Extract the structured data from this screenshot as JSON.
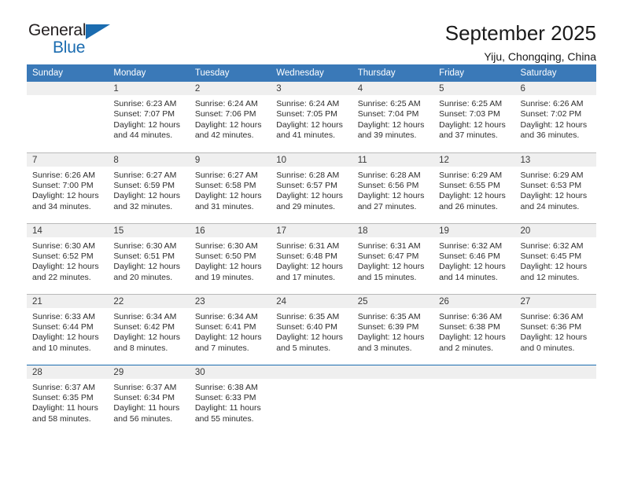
{
  "logo": {
    "word_top": "General",
    "word_bottom": "Blue",
    "triangle_color": "#1b6cb0"
  },
  "header": {
    "title": "September 2025",
    "location": "Yiju, Chongqing, China"
  },
  "theme": {
    "header_blue": "#3a79b8",
    "accent_blue": "#1b6cb0",
    "daynum_band": "#efefef",
    "row_divider": "#b9b9b9"
  },
  "calendar": {
    "weekdays": [
      "Sunday",
      "Monday",
      "Tuesday",
      "Wednesday",
      "Thursday",
      "Friday",
      "Saturday"
    ],
    "weeks": [
      [
        {
          "day": "",
          "sunrise": "",
          "sunset": "",
          "daylight_line1": "",
          "daylight_line2": "",
          "empty": true
        },
        {
          "day": "1",
          "sunrise": "Sunrise: 6:23 AM",
          "sunset": "Sunset: 7:07 PM",
          "daylight_line1": "Daylight: 12 hours",
          "daylight_line2": "and 44 minutes."
        },
        {
          "day": "2",
          "sunrise": "Sunrise: 6:24 AM",
          "sunset": "Sunset: 7:06 PM",
          "daylight_line1": "Daylight: 12 hours",
          "daylight_line2": "and 42 minutes."
        },
        {
          "day": "3",
          "sunrise": "Sunrise: 6:24 AM",
          "sunset": "Sunset: 7:05 PM",
          "daylight_line1": "Daylight: 12 hours",
          "daylight_line2": "and 41 minutes."
        },
        {
          "day": "4",
          "sunrise": "Sunrise: 6:25 AM",
          "sunset": "Sunset: 7:04 PM",
          "daylight_line1": "Daylight: 12 hours",
          "daylight_line2": "and 39 minutes."
        },
        {
          "day": "5",
          "sunrise": "Sunrise: 6:25 AM",
          "sunset": "Sunset: 7:03 PM",
          "daylight_line1": "Daylight: 12 hours",
          "daylight_line2": "and 37 minutes."
        },
        {
          "day": "6",
          "sunrise": "Sunrise: 6:26 AM",
          "sunset": "Sunset: 7:02 PM",
          "daylight_line1": "Daylight: 12 hours",
          "daylight_line2": "and 36 minutes."
        }
      ],
      [
        {
          "day": "7",
          "sunrise": "Sunrise: 6:26 AM",
          "sunset": "Sunset: 7:00 PM",
          "daylight_line1": "Daylight: 12 hours",
          "daylight_line2": "and 34 minutes."
        },
        {
          "day": "8",
          "sunrise": "Sunrise: 6:27 AM",
          "sunset": "Sunset: 6:59 PM",
          "daylight_line1": "Daylight: 12 hours",
          "daylight_line2": "and 32 minutes."
        },
        {
          "day": "9",
          "sunrise": "Sunrise: 6:27 AM",
          "sunset": "Sunset: 6:58 PM",
          "daylight_line1": "Daylight: 12 hours",
          "daylight_line2": "and 31 minutes."
        },
        {
          "day": "10",
          "sunrise": "Sunrise: 6:28 AM",
          "sunset": "Sunset: 6:57 PM",
          "daylight_line1": "Daylight: 12 hours",
          "daylight_line2": "and 29 minutes."
        },
        {
          "day": "11",
          "sunrise": "Sunrise: 6:28 AM",
          "sunset": "Sunset: 6:56 PM",
          "daylight_line1": "Daylight: 12 hours",
          "daylight_line2": "and 27 minutes."
        },
        {
          "day": "12",
          "sunrise": "Sunrise: 6:29 AM",
          "sunset": "Sunset: 6:55 PM",
          "daylight_line1": "Daylight: 12 hours",
          "daylight_line2": "and 26 minutes."
        },
        {
          "day": "13",
          "sunrise": "Sunrise: 6:29 AM",
          "sunset": "Sunset: 6:53 PM",
          "daylight_line1": "Daylight: 12 hours",
          "daylight_line2": "and 24 minutes."
        }
      ],
      [
        {
          "day": "14",
          "sunrise": "Sunrise: 6:30 AM",
          "sunset": "Sunset: 6:52 PM",
          "daylight_line1": "Daylight: 12 hours",
          "daylight_line2": "and 22 minutes."
        },
        {
          "day": "15",
          "sunrise": "Sunrise: 6:30 AM",
          "sunset": "Sunset: 6:51 PM",
          "daylight_line1": "Daylight: 12 hours",
          "daylight_line2": "and 20 minutes."
        },
        {
          "day": "16",
          "sunrise": "Sunrise: 6:30 AM",
          "sunset": "Sunset: 6:50 PM",
          "daylight_line1": "Daylight: 12 hours",
          "daylight_line2": "and 19 minutes."
        },
        {
          "day": "17",
          "sunrise": "Sunrise: 6:31 AM",
          "sunset": "Sunset: 6:48 PM",
          "daylight_line1": "Daylight: 12 hours",
          "daylight_line2": "and 17 minutes."
        },
        {
          "day": "18",
          "sunrise": "Sunrise: 6:31 AM",
          "sunset": "Sunset: 6:47 PM",
          "daylight_line1": "Daylight: 12 hours",
          "daylight_line2": "and 15 minutes."
        },
        {
          "day": "19",
          "sunrise": "Sunrise: 6:32 AM",
          "sunset": "Sunset: 6:46 PM",
          "daylight_line1": "Daylight: 12 hours",
          "daylight_line2": "and 14 minutes."
        },
        {
          "day": "20",
          "sunrise": "Sunrise: 6:32 AM",
          "sunset": "Sunset: 6:45 PM",
          "daylight_line1": "Daylight: 12 hours",
          "daylight_line2": "and 12 minutes."
        }
      ],
      [
        {
          "day": "21",
          "sunrise": "Sunrise: 6:33 AM",
          "sunset": "Sunset: 6:44 PM",
          "daylight_line1": "Daylight: 12 hours",
          "daylight_line2": "and 10 minutes."
        },
        {
          "day": "22",
          "sunrise": "Sunrise: 6:34 AM",
          "sunset": "Sunset: 6:42 PM",
          "daylight_line1": "Daylight: 12 hours",
          "daylight_line2": "and 8 minutes."
        },
        {
          "day": "23",
          "sunrise": "Sunrise: 6:34 AM",
          "sunset": "Sunset: 6:41 PM",
          "daylight_line1": "Daylight: 12 hours",
          "daylight_line2": "and 7 minutes."
        },
        {
          "day": "24",
          "sunrise": "Sunrise: 6:35 AM",
          "sunset": "Sunset: 6:40 PM",
          "daylight_line1": "Daylight: 12 hours",
          "daylight_line2": "and 5 minutes."
        },
        {
          "day": "25",
          "sunrise": "Sunrise: 6:35 AM",
          "sunset": "Sunset: 6:39 PM",
          "daylight_line1": "Daylight: 12 hours",
          "daylight_line2": "and 3 minutes."
        },
        {
          "day": "26",
          "sunrise": "Sunrise: 6:36 AM",
          "sunset": "Sunset: 6:38 PM",
          "daylight_line1": "Daylight: 12 hours",
          "daylight_line2": "and 2 minutes."
        },
        {
          "day": "27",
          "sunrise": "Sunrise: 6:36 AM",
          "sunset": "Sunset: 6:36 PM",
          "daylight_line1": "Daylight: 12 hours",
          "daylight_line2": "and 0 minutes."
        }
      ],
      [
        {
          "day": "28",
          "sunrise": "Sunrise: 6:37 AM",
          "sunset": "Sunset: 6:35 PM",
          "daylight_line1": "Daylight: 11 hours",
          "daylight_line2": "and 58 minutes."
        },
        {
          "day": "29",
          "sunrise": "Sunrise: 6:37 AM",
          "sunset": "Sunset: 6:34 PM",
          "daylight_line1": "Daylight: 11 hours",
          "daylight_line2": "and 56 minutes."
        },
        {
          "day": "30",
          "sunrise": "Sunrise: 6:38 AM",
          "sunset": "Sunset: 6:33 PM",
          "daylight_line1": "Daylight: 11 hours",
          "daylight_line2": "and 55 minutes."
        },
        {
          "day": "",
          "sunrise": "",
          "sunset": "",
          "daylight_line1": "",
          "daylight_line2": "",
          "empty": true
        },
        {
          "day": "",
          "sunrise": "",
          "sunset": "",
          "daylight_line1": "",
          "daylight_line2": "",
          "empty": true
        },
        {
          "day": "",
          "sunrise": "",
          "sunset": "",
          "daylight_line1": "",
          "daylight_line2": "",
          "empty": true
        },
        {
          "day": "",
          "sunrise": "",
          "sunset": "",
          "daylight_line1": "",
          "daylight_line2": "",
          "empty": true
        }
      ]
    ]
  }
}
